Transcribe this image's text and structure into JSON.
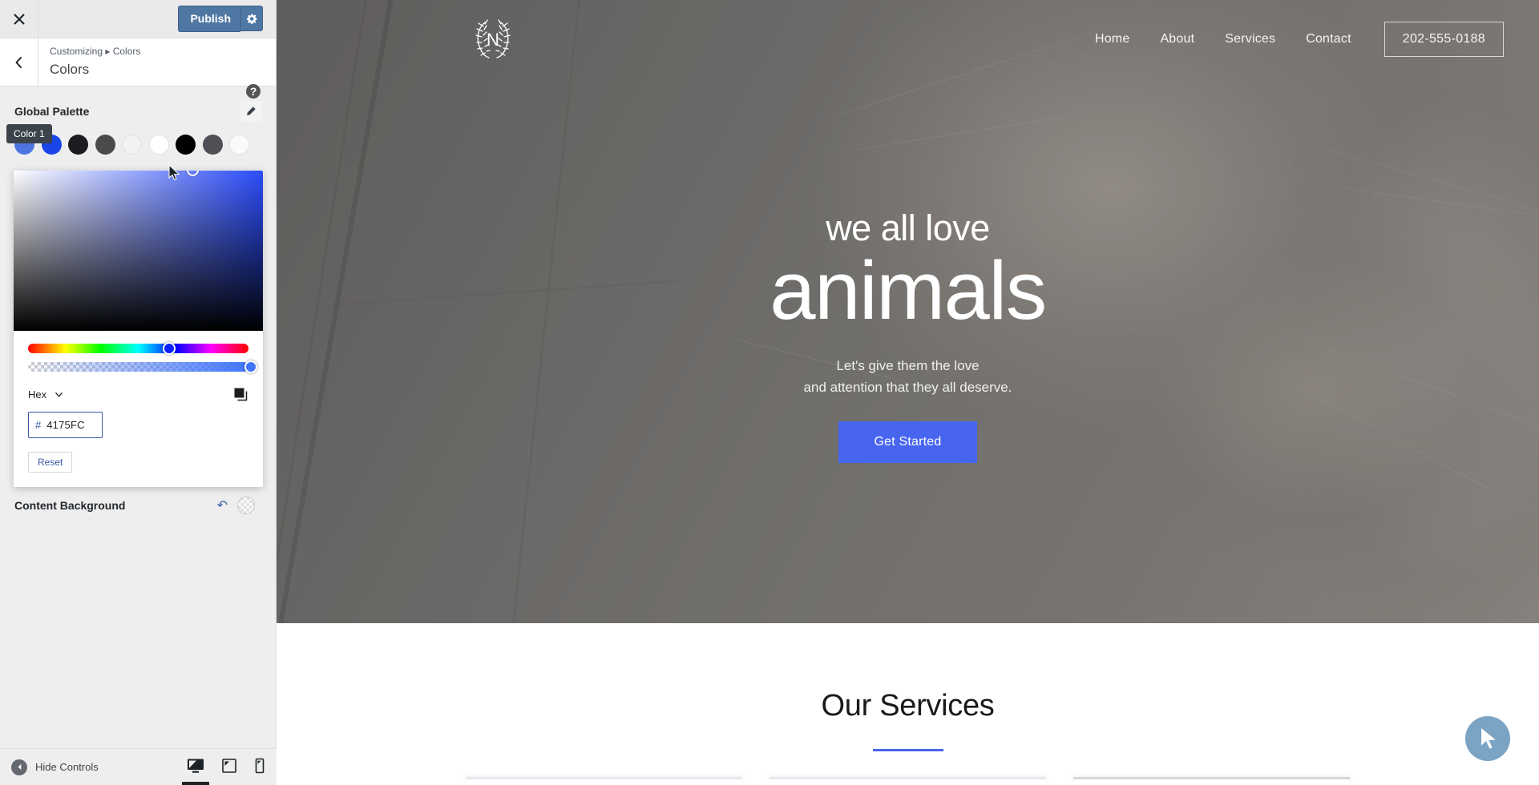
{
  "customizer": {
    "close_label": "Close",
    "publish_label": "Publish",
    "publish_settings_icon": "gear-icon",
    "back_icon": "chevron-left-icon",
    "breadcrumb": "Customizing ▸ Colors",
    "panel_title": "Colors",
    "help_icon": "help-question-icon",
    "global_palette_label": "Global Palette",
    "edit_icon": "pencil-icon",
    "tooltip": "Color 1",
    "swatches": [
      {
        "name": "color-1",
        "hex": "#4e74e0"
      },
      {
        "name": "color-2",
        "hex": "#1a45e8"
      },
      {
        "name": "color-3",
        "hex": "#1c1c20"
      },
      {
        "name": "color-4",
        "hex": "#4a4a4d"
      },
      {
        "name": "color-5",
        "hex": "#f2f2f2"
      },
      {
        "name": "color-6",
        "hex": "#ffffff"
      },
      {
        "name": "color-7",
        "hex": "#000000"
      },
      {
        "name": "color-8",
        "hex": "#4f5055"
      },
      {
        "name": "color-9",
        "hex": "#fafafa"
      }
    ],
    "picker": {
      "format_label": "Hex",
      "format_caret_icon": "chevron-down-icon",
      "copy_icon": "copy-icon",
      "hash_symbol": "#",
      "hex_value": "4175FC",
      "reset_label": "Reset",
      "selected_color": "#4175FC"
    },
    "content_background": {
      "label": "Content Background",
      "undo_icon": "undo-icon",
      "swatch_icon": "transparent-swatch-icon"
    },
    "footer": {
      "hide_controls_label": "Hide Controls",
      "collapse_icon": "collapse-left-icon",
      "devices": [
        {
          "name": "desktop",
          "icon": "desktop-icon",
          "active": true
        },
        {
          "name": "tablet",
          "icon": "tablet-icon",
          "active": false
        },
        {
          "name": "mobile",
          "icon": "mobile-icon",
          "active": false
        }
      ]
    }
  },
  "site": {
    "logo": {
      "letter": "N",
      "icon": "laurel-wreath-logo"
    },
    "nav": [
      {
        "label": "Home"
      },
      {
        "label": "About"
      },
      {
        "label": "Services"
      },
      {
        "label": "Contact"
      }
    ],
    "phone": "202-555-0188",
    "hero": {
      "line1": "we all love",
      "line2": "animals",
      "sub_line1": "Let's give them the love",
      "sub_line2": "and attention that they all deserve.",
      "cta_label": "Get Started",
      "cta_color": "#4865f0"
    },
    "services": {
      "title": "Our Services",
      "rule_color": "#4865f0"
    },
    "cursor_badge_icon": "pointer-cursor-icon"
  }
}
